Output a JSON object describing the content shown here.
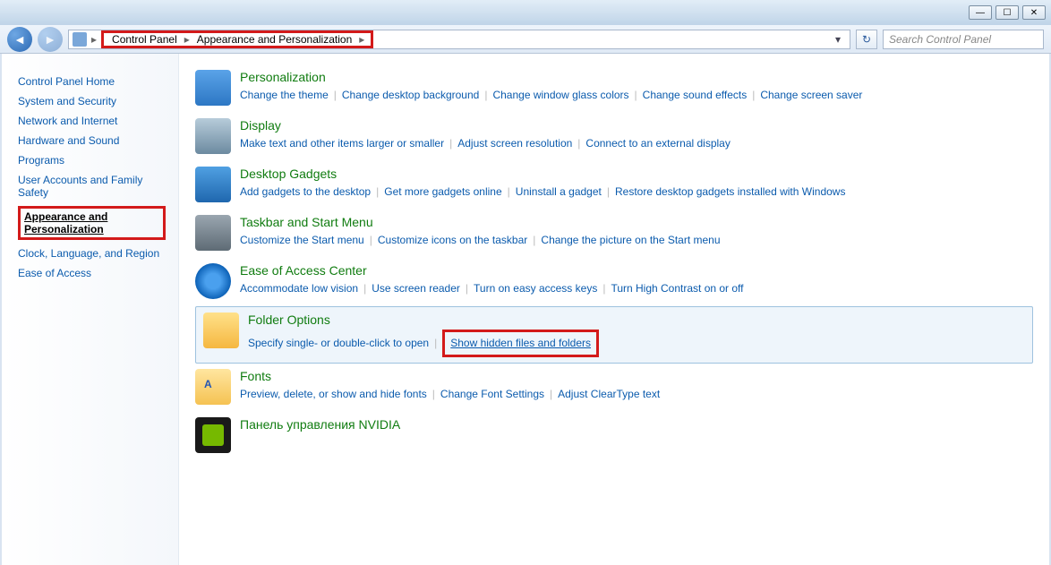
{
  "window": {
    "search_placeholder": "Search Control Panel"
  },
  "breadcrumb": {
    "root": "Control Panel",
    "current": "Appearance and Personalization"
  },
  "sidebar": {
    "home": "Control Panel Home",
    "items": [
      "System and Security",
      "Network and Internet",
      "Hardware and Sound",
      "Programs",
      "User Accounts and Family Safety",
      "Appearance and Personalization",
      "Clock, Language, and Region",
      "Ease of Access"
    ]
  },
  "categories": [
    {
      "title": "Personalization",
      "icon": "ic-personalization",
      "tasks": [
        "Change the theme",
        "Change desktop background",
        "Change window glass colors",
        "Change sound effects",
        "Change screen saver"
      ]
    },
    {
      "title": "Display",
      "icon": "ic-display",
      "tasks": [
        "Make text and other items larger or smaller",
        "Adjust screen resolution",
        "Connect to an external display"
      ]
    },
    {
      "title": "Desktop Gadgets",
      "icon": "ic-gadgets",
      "tasks": [
        "Add gadgets to the desktop",
        "Get more gadgets online",
        "Uninstall a gadget",
        "Restore desktop gadgets installed with Windows"
      ]
    },
    {
      "title": "Taskbar and Start Menu",
      "icon": "ic-taskbar",
      "tasks": [
        "Customize the Start menu",
        "Customize icons on the taskbar",
        "Change the picture on the Start menu"
      ]
    },
    {
      "title": "Ease of Access Center",
      "icon": "ic-ease",
      "tasks": [
        "Accommodate low vision",
        "Use screen reader",
        "Turn on easy access keys",
        "Turn High Contrast on or off"
      ]
    },
    {
      "title": "Folder Options",
      "icon": "ic-folder",
      "selected": true,
      "tasks": [
        "Specify single- or double-click to open",
        "Show hidden files and folders"
      ],
      "highlight_task_index": 1
    },
    {
      "title": "Fonts",
      "icon": "ic-fonts",
      "tasks": [
        "Preview, delete, or show and hide fonts",
        "Change Font Settings",
        "Adjust ClearType text"
      ]
    },
    {
      "title": "Панель управления NVIDIA",
      "icon": "ic-nvidia",
      "tasks": []
    }
  ]
}
